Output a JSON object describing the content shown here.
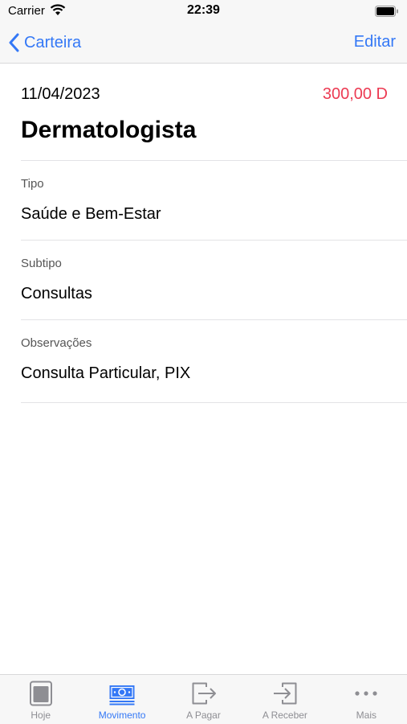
{
  "status_bar": {
    "carrier": "Carrier",
    "time": "22:39"
  },
  "nav": {
    "back_label": "Carteira",
    "edit_label": "Editar"
  },
  "entry": {
    "date": "11/04/2023",
    "amount": "300,00 D",
    "title": "Dermatologista"
  },
  "fields": [
    {
      "label": "Tipo",
      "value": "Saúde e Bem-Estar"
    },
    {
      "label": "Subtipo",
      "value": "Consultas"
    },
    {
      "label": "Observações",
      "value": "Consulta Particular, PIX"
    }
  ],
  "tabs": [
    {
      "label": "Hoje",
      "icon": "calendar-icon",
      "active": false
    },
    {
      "label": "Movimento",
      "icon": "banknote-icon",
      "active": true
    },
    {
      "label": "A Pagar",
      "icon": "arrow-out-icon",
      "active": false
    },
    {
      "label": "A Receber",
      "icon": "arrow-in-icon",
      "active": false
    },
    {
      "label": "Mais",
      "icon": "more-icon",
      "active": false
    }
  ],
  "colors": {
    "accent": "#3478f6",
    "debit": "#ec3a52",
    "inactive": "#8e8e93"
  }
}
